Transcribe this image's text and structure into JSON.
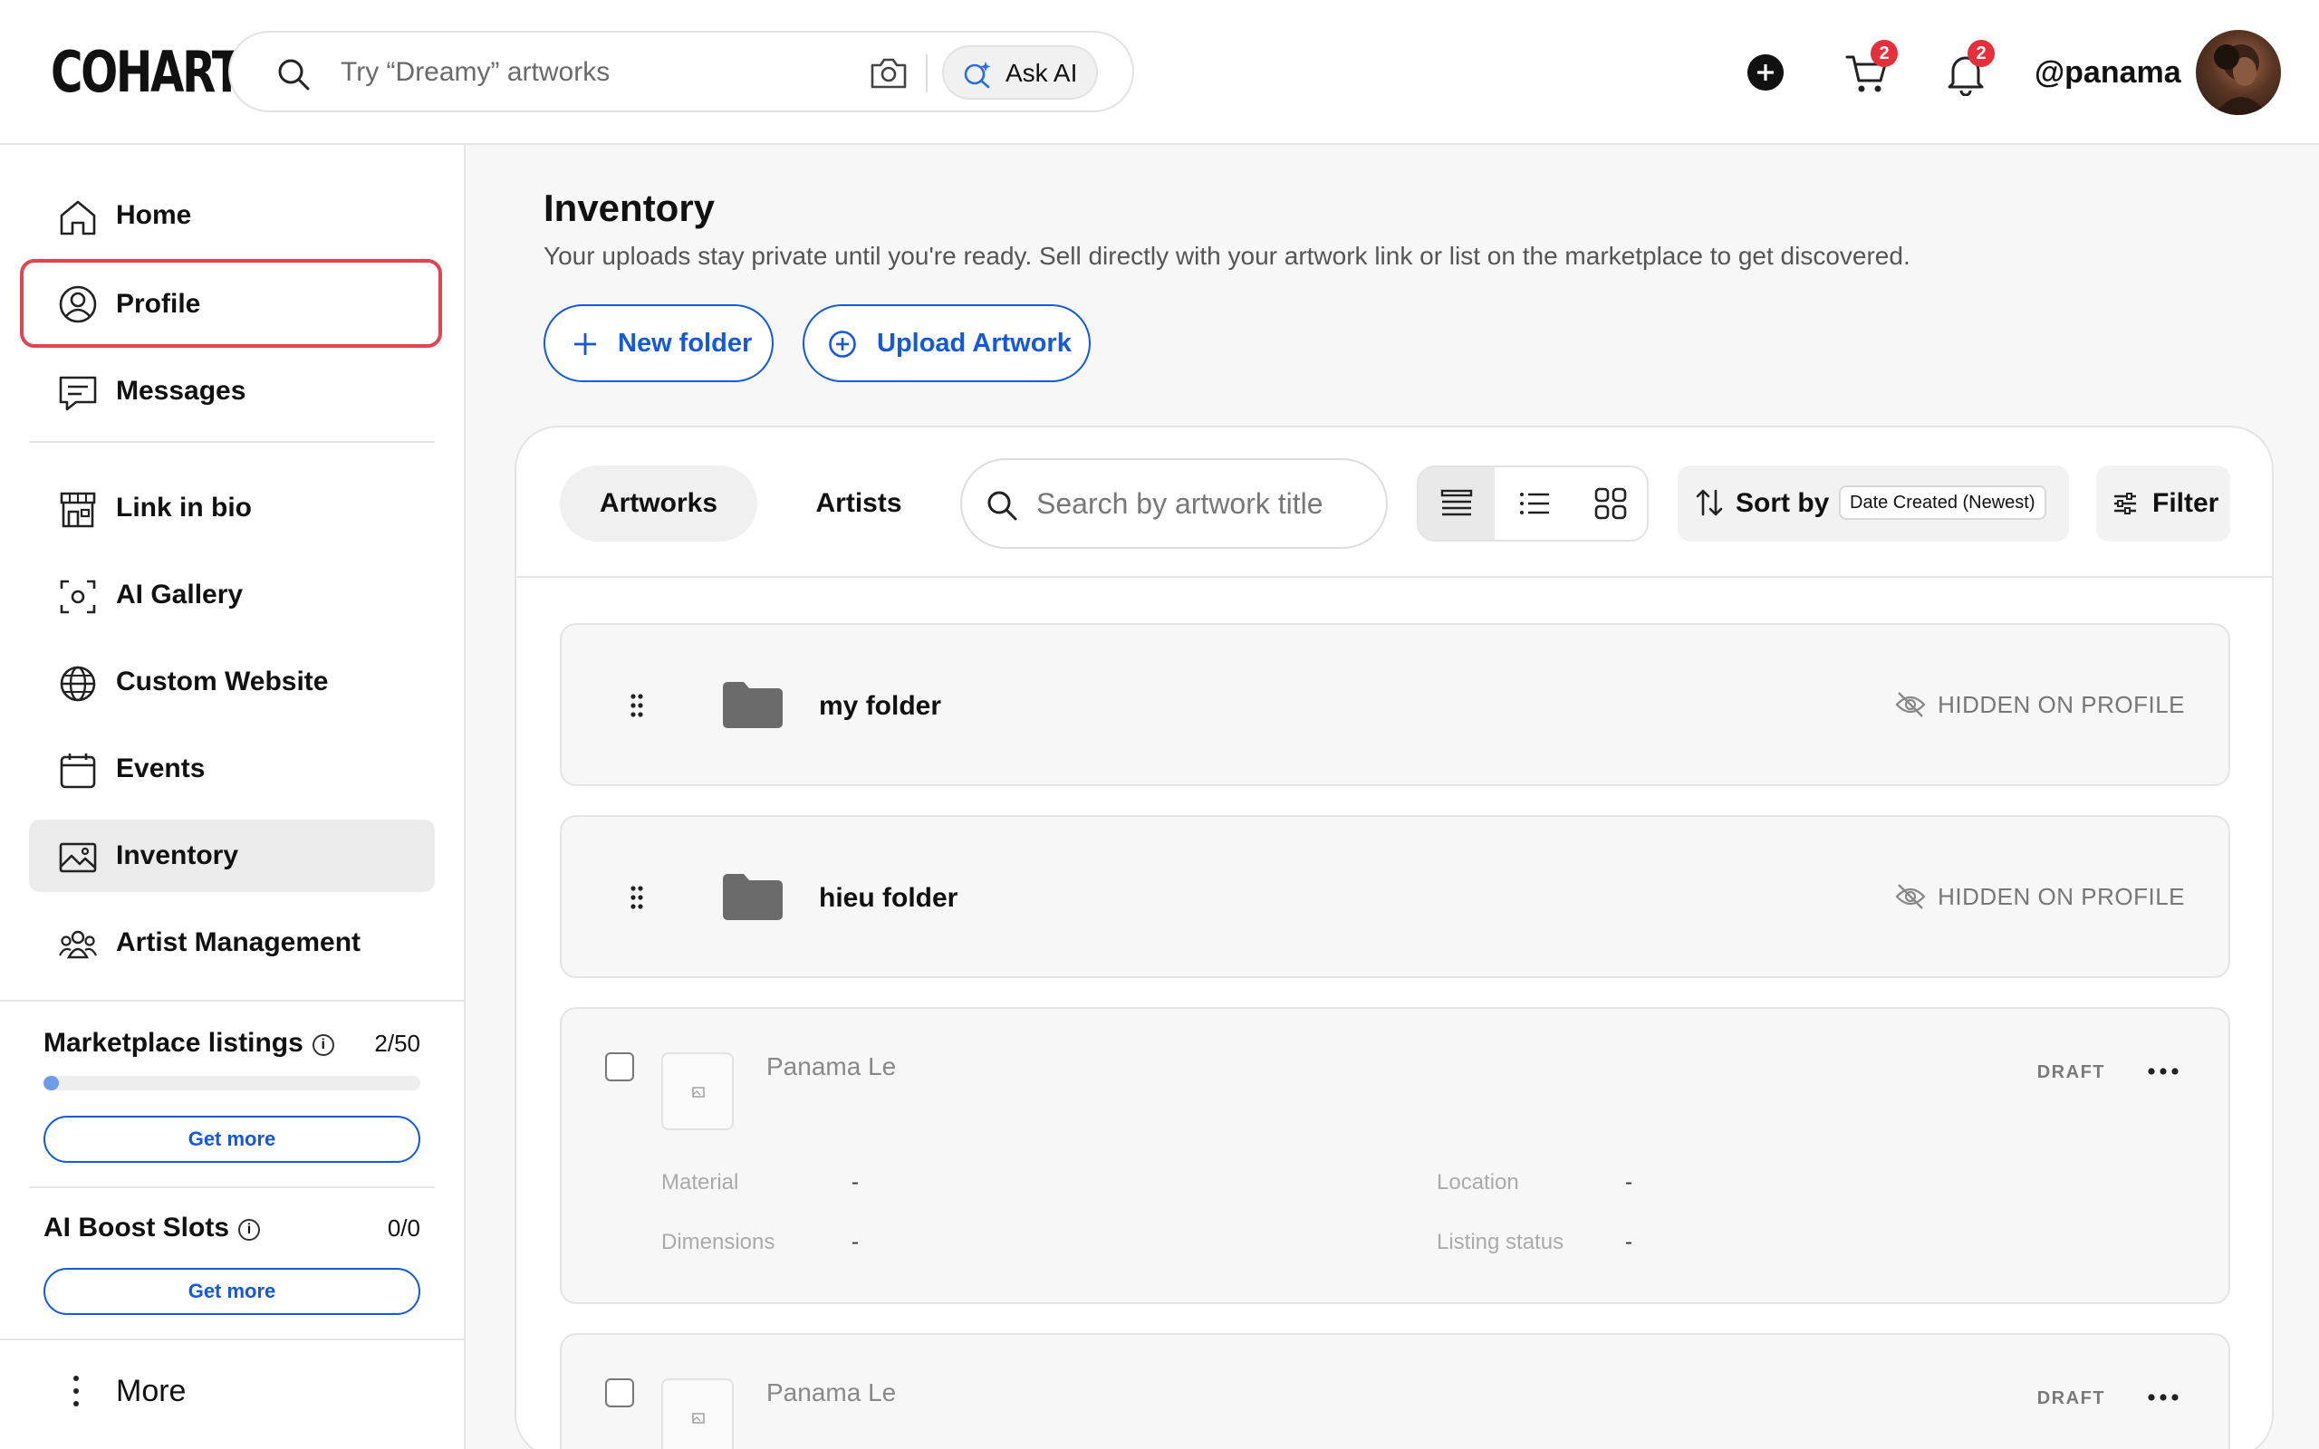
{
  "header": {
    "logo": "COHART",
    "search_placeholder": "Try “Dreamy” artworks",
    "ask_ai_label": "Ask AI",
    "cart_count": "2",
    "notifications_count": "2",
    "username": "@panama"
  },
  "sidebar": {
    "items": [
      {
        "label": "Home"
      },
      {
        "label": "Profile"
      },
      {
        "label": "Messages"
      },
      {
        "label": "Link in bio"
      },
      {
        "label": "AI Gallery"
      },
      {
        "label": "Custom Website"
      },
      {
        "label": "Events"
      },
      {
        "label": "Inventory"
      },
      {
        "label": "Artist Management"
      }
    ],
    "marketplace": {
      "label": "Marketplace listings",
      "count": "2/50",
      "used": 2,
      "total": 50,
      "button": "Get more"
    },
    "ai_boost": {
      "label": "AI Boost Slots",
      "count": "0/0",
      "button": "Get more"
    },
    "more_label": "More"
  },
  "main": {
    "title": "Inventory",
    "subtitle": "Your uploads stay private until you're ready. Sell directly with your artwork link or list on the marketplace to get discovered.",
    "new_folder_label": "New folder",
    "upload_label": "Upload Artwork"
  },
  "toolbar": {
    "tabs": [
      "Artworks",
      "Artists"
    ],
    "search_placeholder": "Search by artwork title",
    "sort_label": "Sort by",
    "sort_value": "Date Created (Newest)",
    "filter_label": "Filter"
  },
  "folders": [
    {
      "name": "my folder",
      "visibility": "HIDDEN ON PROFILE"
    },
    {
      "name": "hieu folder",
      "visibility": "HIDDEN ON PROFILE"
    }
  ],
  "artworks": [
    {
      "artist": "Panama Le",
      "status": "DRAFT",
      "fields": {
        "material_label": "Material",
        "material_value": "-",
        "location_label": "Location",
        "location_value": "-",
        "dimensions_label": "Dimensions",
        "dimensions_value": "-",
        "listing_label": "Listing status",
        "listing_value": "-"
      }
    },
    {
      "artist": "Panama Le",
      "status": "DRAFT"
    }
  ],
  "colors": {
    "accent": "#1459d9",
    "badge": "#e5303c",
    "highlight_outline": "#e04550"
  }
}
